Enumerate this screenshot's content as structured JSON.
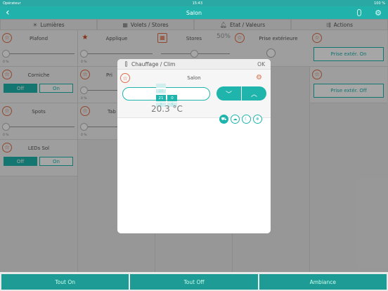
{
  "status": {
    "carrier": "Opérateur",
    "time": "15:43",
    "battery": "100 %"
  },
  "nav": {
    "title": "Salon"
  },
  "tabs": [
    {
      "label": "Lumières",
      "icon": "bulb-icon"
    },
    {
      "label": "Volets / Stores",
      "icon": "grid-icon"
    },
    {
      "label": "Etat / Valeurs",
      "icon": "bell-icon"
    },
    {
      "label": "Actions",
      "icon": "share-icon"
    }
  ],
  "lights_a": [
    {
      "label": "Plafond",
      "type": "slider",
      "value": "0 %",
      "fill": 0
    },
    {
      "label": "Corniche",
      "type": "toggle",
      "off": "Off",
      "on": "On"
    },
    {
      "label": "Spots",
      "type": "slider",
      "value": "0 %",
      "fill": 0
    },
    {
      "label": "LEDs Sol",
      "type": "toggle",
      "off": "Off",
      "on": "On"
    }
  ],
  "lights_b": [
    {
      "label": "Applique",
      "value": "0 %",
      "fill": 0
    },
    {
      "label": "Pri",
      "value": "0 %",
      "fill": 0
    },
    {
      "label": "Tab",
      "value": "0 %",
      "fill": 0
    }
  ],
  "stores": {
    "label": "Stores",
    "value": "50%",
    "fill": 0.5
  },
  "etat": {
    "label": "Prise extérieure"
  },
  "actions": [
    {
      "label": "Prise extér. On"
    },
    {
      "label": "Prise extér. Off"
    }
  ],
  "bottom": {
    "b1": "Tout On",
    "b2": "Tout Off",
    "b3": "Ambiance"
  },
  "modal": {
    "title": "Chauffage / Clim",
    "ok": "OK",
    "location": "Salon",
    "setpoint": "20.3 °C",
    "picker": {
      "above": "20",
      "hour": "21",
      "min": "0",
      "below1": "2",
      "below2": "5"
    },
    "down": "﹀",
    "up": "︿",
    "modes": [
      "car-icon",
      "cloud-icon",
      "moon-icon",
      "snowflake-icon"
    ]
  }
}
